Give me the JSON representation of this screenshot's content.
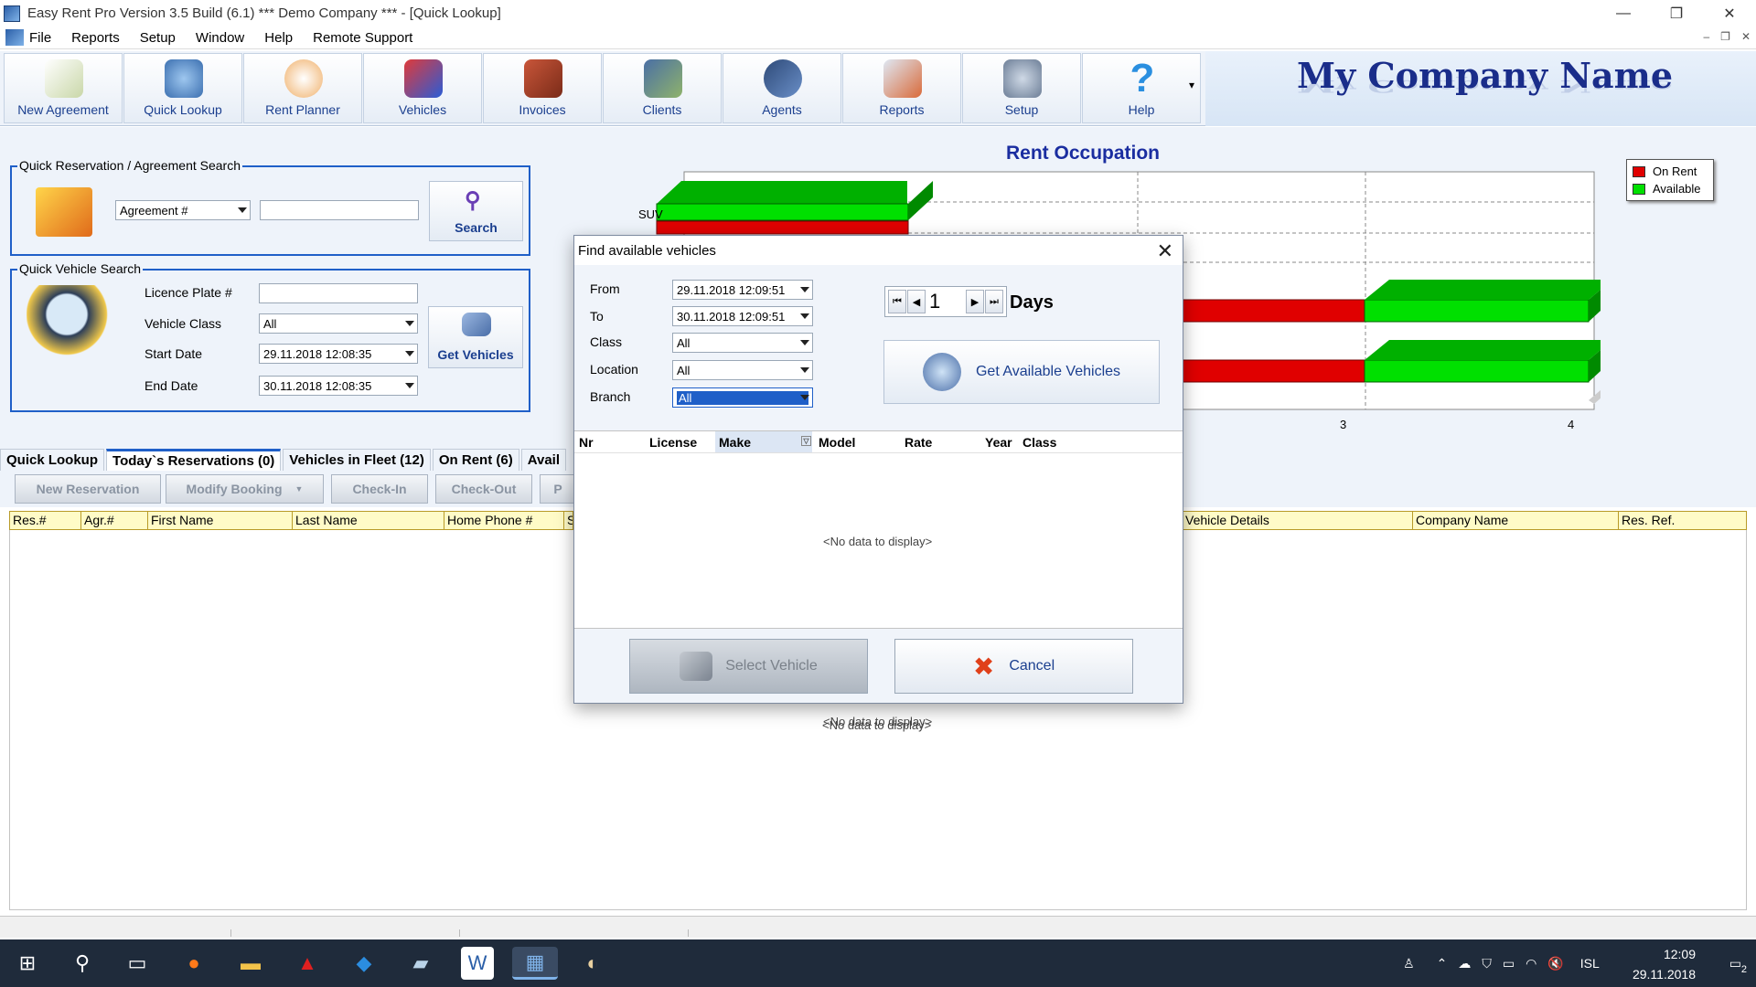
{
  "window": {
    "title": "Easy Rent Pro  Version 3.5 Build (6.1)  *** Demo Company *** - [Quick Lookup]",
    "buttons": [
      "—",
      "❐",
      "✕"
    ]
  },
  "menu": {
    "items": [
      "File",
      "Reports",
      "Setup",
      "Window",
      "Help",
      "Remote Support"
    ],
    "mdi_buttons": [
      "–",
      "❐",
      "✕"
    ]
  },
  "toolbar": {
    "buttons": [
      {
        "label": "New Agreement",
        "icon": "new-agreement-icon"
      },
      {
        "label": "Quick Lookup",
        "icon": "quick-lookup-icon"
      },
      {
        "label": "Rent Planner",
        "icon": "rent-planner-icon"
      },
      {
        "label": "Vehicles",
        "icon": "vehicles-icon"
      },
      {
        "label": "Invoices",
        "icon": "invoices-icon"
      },
      {
        "label": "Clients",
        "icon": "clients-icon"
      },
      {
        "label": "Agents",
        "icon": "agents-icon"
      },
      {
        "label": "Reports",
        "icon": "reports-icon"
      },
      {
        "label": "Setup",
        "icon": "setup-icon"
      },
      {
        "label": "Help",
        "icon": "help-icon"
      }
    ],
    "overflow": "▾"
  },
  "brand": {
    "company_name": "My Company Name"
  },
  "quick_reservation": {
    "title": "Quick Reservation / Agreement Search",
    "search_type": "Agreement #",
    "search_value": "",
    "search_button": "Search"
  },
  "quick_vehicle": {
    "title": "Quick  Vehicle Search",
    "licence_label": "Licence Plate #",
    "licence_value": "",
    "class_label": "Vehicle Class",
    "class_value": "All",
    "start_label": "Start Date",
    "start_value": "29.11.2018 12:08:35",
    "end_label": "End Date",
    "end_value": "30.11.2018 12:08:35",
    "get_button": "Get Vehicles"
  },
  "chart_data": {
    "type": "bar",
    "title": "Rent Occupation",
    "visible_categories": [
      "SUV"
    ],
    "x_ticks": [
      "3",
      "4"
    ],
    "legend": [
      "On Rent",
      "Available"
    ],
    "legend_placement": "top-right",
    "colors": {
      "on_rent": "#e00000",
      "available": "#00e000"
    },
    "grid": true
  },
  "tabs": [
    {
      "label": "Quick Lookup",
      "active": false
    },
    {
      "label": "Today`s Reservations (0)",
      "active": true
    },
    {
      "label": "Vehicles in Fleet (12)",
      "active": false
    },
    {
      "label": "On Rent (6)",
      "active": false
    },
    {
      "label": "Avail",
      "active": false
    }
  ],
  "actions": [
    "New Reservation",
    "Modify Booking",
    "Check-In",
    "Check-Out",
    "P"
  ],
  "grid": {
    "columns": [
      "Res.#",
      "Agr.#",
      "First Name",
      "Last Name",
      "Home Phone #",
      "S",
      "",
      "Vehicle Details",
      "Company Name",
      "Res. Ref."
    ],
    "empty_text": "<No data to display>"
  },
  "dialog": {
    "title": "Find available vehicles",
    "from_label": "From",
    "from_value": "29.11.2018 12:09:51",
    "to_label": "To",
    "to_value": "30.11.2018 12:09:51",
    "class_label": "Class",
    "class_value": "All",
    "location_label": "Location",
    "location_value": "All",
    "branch_label": "Branch",
    "branch_value": "All",
    "days_value": "1",
    "days_label": "Days",
    "get_button": "Get Available Vehicles",
    "columns": [
      "Nr",
      "License",
      "Make",
      "Model",
      "Rate",
      "Year",
      "Class"
    ],
    "empty_text": "<No data to display>",
    "select_button": "Select Vehicle",
    "cancel_button": "Cancel"
  },
  "taskbar": {
    "lang": "ISL",
    "time": "12:09",
    "date": "29.11.2018",
    "notifications": "2"
  }
}
